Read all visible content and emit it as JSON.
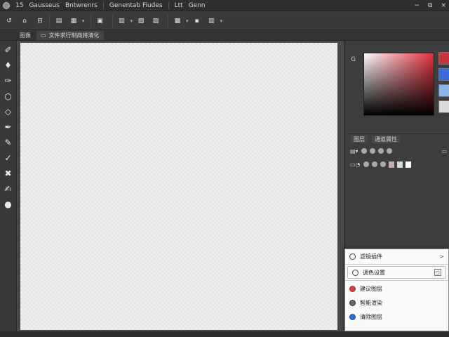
{
  "menubar": {
    "items": [
      "15",
      "Gausseus",
      "Bntwrenrs",
      "Genentab Fiudes",
      "Ltt",
      "Genn"
    ],
    "window_controls": [
      "−",
      "⧉",
      "×"
    ]
  },
  "toolbar": {
    "buttons": [
      "↺",
      "⌂",
      "⊟",
      "▤",
      "▦",
      "▣",
      "▥",
      "▧",
      "▨",
      "▩",
      "▪",
      "▥"
    ]
  },
  "optionsbar": {
    "tab_label": "图像",
    "doc_label": "文件求行制商将清化"
  },
  "tools": [
    "✐",
    "♦",
    "✑",
    "○",
    "◇",
    "✒",
    "✎",
    "✓",
    "✖",
    "✍",
    "●"
  ],
  "panel": {
    "color_label": "G",
    "swatches": [
      "#c8363d",
      "#3b6bd8",
      "#8ab5e8",
      "#d9d9d9"
    ],
    "layer_tabs": [
      "图层",
      "通道属性"
    ]
  },
  "context_menu": {
    "items": [
      {
        "label": "滤镜插件",
        "icon": "circle-outline-icon",
        "trailing": ">"
      },
      {
        "label": "调色设置",
        "icon": "settings-icon",
        "trailing": "□"
      },
      {
        "label": "建议图层",
        "icon": "red-circle-icon"
      },
      {
        "label": "智能渲染",
        "icon": "gray-circle-icon"
      },
      {
        "label": "清除图层",
        "icon": "blue-circle-icon"
      }
    ]
  },
  "statusbar": {
    "items": [
      "",
      "",
      "",
      ""
    ]
  }
}
